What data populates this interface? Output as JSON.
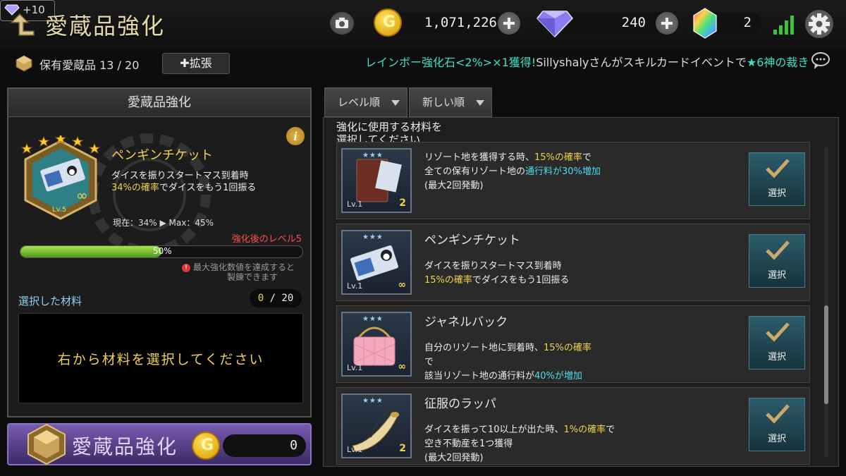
{
  "header": {
    "title": "愛蔵品強化",
    "boost_label": "+10",
    "gold": "1,071,226",
    "diamonds": "240",
    "rainbow_stones": "2"
  },
  "collection": {
    "label": "保有愛蔵品 13 / 20",
    "expand_label": "✚拡張"
  },
  "ticker": {
    "highlight": "レインボー強化石<2%>×1獲得!",
    "rest": "Sillyshalyさんがスキルカードイベントで",
    "item": "★6神の裁き"
  },
  "left_panel": {
    "title": "愛蔵品強化",
    "item": {
      "name": "ペンギンチケット",
      "desc_line1": "ダイスを振りスタートマス到着時",
      "desc_highlight": "34%の確率",
      "desc_line2_rest": "でダイスをもう1回振る",
      "level": "Lv.5",
      "stars": 5,
      "current_max": "現在：34% ▶ Max：45%"
    },
    "after_level": "強化後のレベル5",
    "progress_label": "50%",
    "progress": 0.5,
    "warning_line1": "最大強化数値を達成すると",
    "warning_line2": "製錬できます",
    "selected_label": "選択した材料",
    "selected_current": "0",
    "selected_max": " / 20",
    "selected_hint": "右から材料を選択してください"
  },
  "enhance_button": {
    "label": "愛蔵品強化",
    "cost": "0"
  },
  "sort": {
    "level": "レベル順",
    "newest": "新しい順"
  },
  "materials": {
    "hint_line1": "強化に使用する材料を",
    "hint_line2": "選択してください",
    "select_label": "選択",
    "items": [
      {
        "name": "",
        "lines": [
          [
            {
              "t": "リゾート地を獲得する時、"
            },
            {
              "t": "15%の確率",
              "c": "y"
            },
            {
              "t": "で"
            }
          ],
          [
            {
              "t": "全ての保有リゾート地の"
            },
            {
              "t": "通行料が30%増加",
              "c": "c"
            }
          ],
          [
            {
              "t": "(最大2回発動)"
            }
          ]
        ],
        "level": "Lv.1",
        "count": "2",
        "icon": "book-icon"
      },
      {
        "name": "ペンギンチケット",
        "lines": [
          [
            {
              "t": "ダイスを振りスタートマス到着時"
            }
          ],
          [
            {
              "t": "15%の確率",
              "c": "y"
            },
            {
              "t": "でダイスをもう1回振る"
            }
          ]
        ],
        "level": "Lv.1",
        "count": "∞",
        "icon": "ticket-icon"
      },
      {
        "name": "ジャネルバック",
        "lines": [
          [
            {
              "t": "自分のリゾート地に到着時、"
            },
            {
              "t": "15%の確率",
              "c": "y"
            }
          ],
          [
            {
              "t": "で"
            }
          ],
          [
            {
              "t": "該当リゾート地の通行料が"
            },
            {
              "t": "40%が増加",
              "c": "c"
            }
          ]
        ],
        "level": "Lv.1",
        "count": "∞",
        "icon": "handbag-icon"
      },
      {
        "name": "征服のラッパ",
        "lines": [
          [
            {
              "t": "ダイスを振って10以上が出た時、"
            },
            {
              "t": "1%の確率",
              "c": "y"
            },
            {
              "t": "で"
            }
          ],
          [
            {
              "t": "空き不動産を1つ獲得"
            }
          ],
          [
            {
              "t": "(最大2回発動)"
            }
          ]
        ],
        "level": "Lv.1",
        "count": "2",
        "icon": "horn-icon"
      }
    ]
  }
}
